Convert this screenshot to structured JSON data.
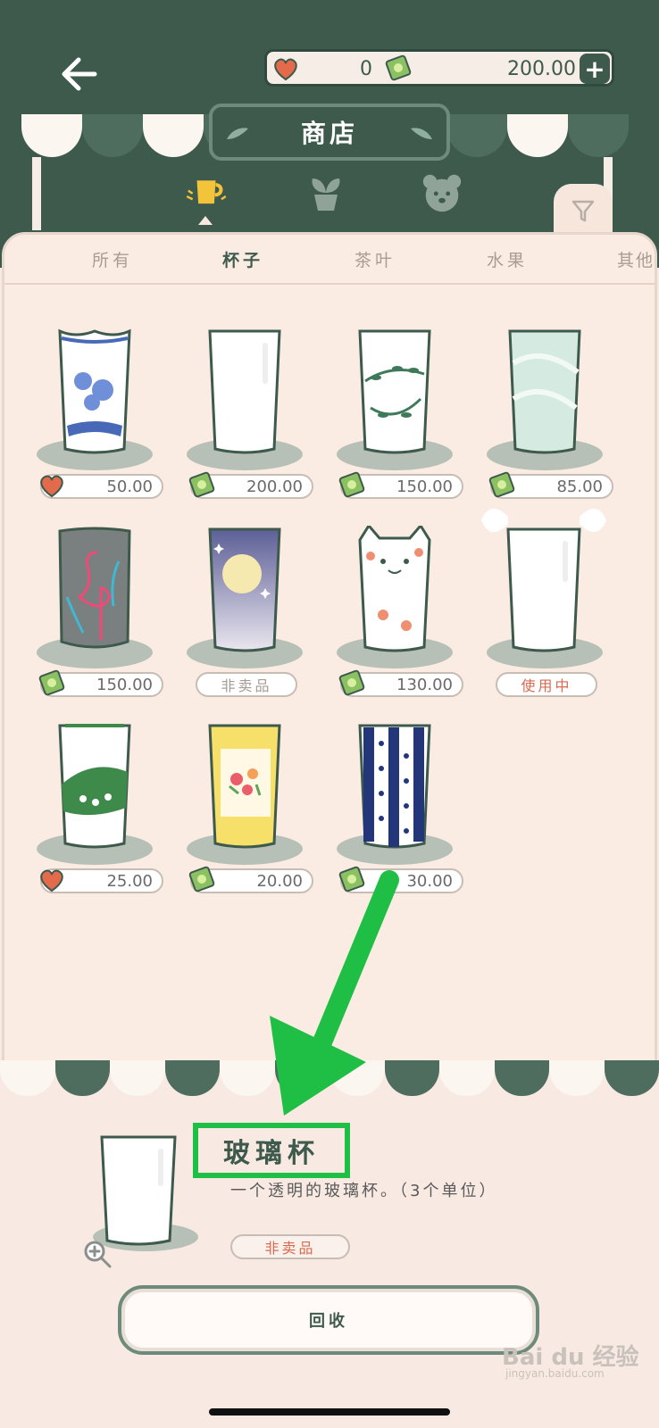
{
  "header": {
    "back_icon": "arrow-left-icon",
    "hearts": "0",
    "cash": "200.00",
    "add_label": "+"
  },
  "shop": {
    "title": "商店",
    "category_icons": [
      "cup-icon",
      "plant-icon",
      "bear-icon"
    ],
    "filter_icon": "funnel-icon"
  },
  "tabs": [
    "所有",
    "杯子",
    "茶叶",
    "水果",
    "其他"
  ],
  "active_tab": "杯子",
  "items": [
    {
      "name": "blue-porcelain-cup",
      "currency": "heart",
      "price": "50.00"
    },
    {
      "name": "plain-glass",
      "currency": "cash",
      "price": "200.00"
    },
    {
      "name": "vine-cup",
      "currency": "cash",
      "price": "150.00"
    },
    {
      "name": "jade-cup",
      "currency": "cash",
      "price": "85.00"
    },
    {
      "name": "flamingo-cup",
      "currency": "cash",
      "price": "150.00"
    },
    {
      "name": "moon-cup",
      "badge": "非卖品"
    },
    {
      "name": "cat-cup",
      "currency": "cash",
      "price": "130.00"
    },
    {
      "name": "bow-glass",
      "badge": "使用中"
    },
    {
      "name": "leaf-cup",
      "currency": "heart",
      "price": "25.00"
    },
    {
      "name": "flower-cup",
      "currency": "cash",
      "price": "20.00"
    },
    {
      "name": "dot-stripe-cup",
      "currency": "cash",
      "price": "30.00"
    }
  ],
  "selected": {
    "name": "玻璃杯",
    "description": "一个透明的玻璃杯。（3个单位）",
    "badge": "非卖品"
  },
  "recycle_label": "回收",
  "watermark": {
    "brand": "Bai du 经验",
    "url": "jingyan.baidu.com"
  },
  "colors": {
    "dark_green": "#3e5a4d",
    "cream": "#f8eae2",
    "highlight": "#1fbe44"
  }
}
